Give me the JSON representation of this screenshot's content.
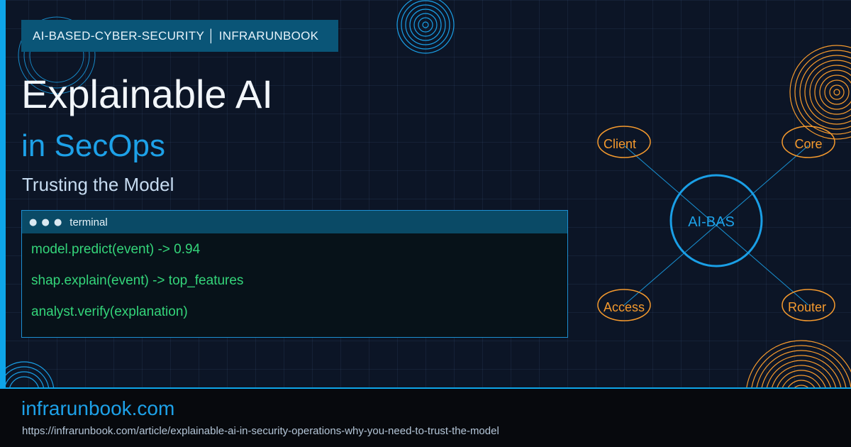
{
  "header_tag": "AI-BASED-CYBER-SECURITY │ INFRARUNBOOK",
  "title": "Explainable AI",
  "subtitle": "in SecOps",
  "tagline": "Trusting the Model",
  "terminal": {
    "dots": "● ● ●",
    "label": "terminal",
    "lines": [
      "model.predict(event) -> 0.94",
      "shap.explain(event) -> top_features",
      "analyst.verify(explanation)"
    ]
  },
  "diagram": {
    "center": "AI-BAS",
    "nodes": [
      "Client",
      "Core",
      "Access",
      "Router"
    ]
  },
  "footer": {
    "site": "infrarunbook.com",
    "url": "https://infrarunbook.com/article/explainable-ai-in-security-operations-why-you-need-to-trust-the-model"
  },
  "colors": {
    "accent": "#0ea5e9",
    "title": "#f2f6fa",
    "subtitle": "#1da1e8",
    "terminal_text": "#34d57a",
    "node_orange": "#f59a2e",
    "background": "#0c1526"
  }
}
